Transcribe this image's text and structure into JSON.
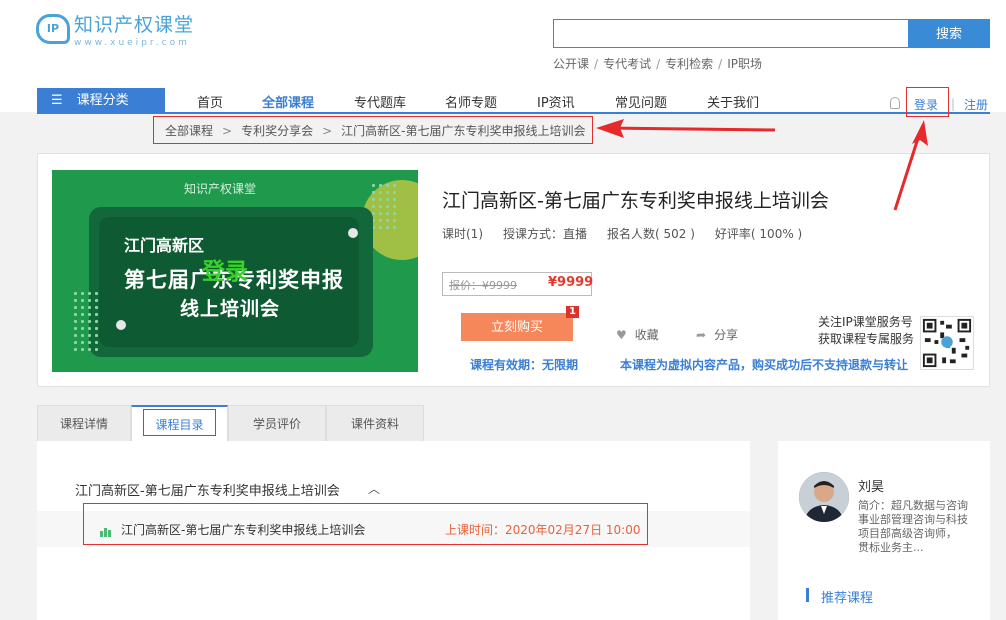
{
  "header": {
    "logo_cn": "知识产权课堂",
    "logo_en": "www.xueipr.com",
    "logo_mark": "IP",
    "search_placeholder": "",
    "search_button": "搜索",
    "quick_links": [
      "公开课",
      "专代考试",
      "专利检索",
      "IP职场"
    ]
  },
  "nav": {
    "category_label": "课程分类",
    "items": [
      "首页",
      "全部课程",
      "专代题库",
      "名师专题",
      "IP资讯",
      "常见问题",
      "关于我们"
    ],
    "active": "全部课程",
    "login": "登录",
    "register": "注册",
    "separator": "|"
  },
  "breadcrumb": [
    "全部课程",
    "专利奖分享会",
    "江门高新区-第七届广东专利奖申报线上培训会"
  ],
  "course": {
    "cover": {
      "logo": "知识产权课堂",
      "line1": "江门高新区",
      "line2": "第七届广东专利奖申报",
      "line3": "线上培训会",
      "overlay": "登录"
    },
    "title": "江门高新区-第七届广东专利奖申报线上培训会",
    "meta": [
      "课时(1)",
      "授课方式：直播",
      "报名人数( 502 )",
      "好评率( 100% )"
    ],
    "price_old": "报价：¥9999",
    "price_new": "¥9999",
    "buy_button": "立刻购买",
    "cart_badge": "1",
    "favorite": "收藏",
    "share": "分享",
    "validity": "课程有效期：无限期",
    "notice": "本课程为虚拟内容产品，购买成功后不支持退款与转让",
    "follow_line1": "关注IP课堂服务号",
    "follow_line2": "获取课程专属服务"
  },
  "tabs": [
    "课程详情",
    "课程目录",
    "学员评价",
    "课件资料"
  ],
  "active_tab": "课程目录",
  "catalog": {
    "chapter": "江门高新区-第七届广东专利奖申报线上培训会",
    "lesson_title": "江门高新区-第七届广东专利奖申报线上培训会",
    "lesson_time": "上课时间：2020年02月27日 10:00"
  },
  "teacher": {
    "name": "刘昊",
    "intro": "简介：超凡数据与咨询事业部管理咨询与科技项目部高级咨询师， 贯标业务主...",
    "recommend": "推荐课程"
  },
  "colors": {
    "accent": "#3a7fd5",
    "buy": "#f5875a",
    "price": "#e23b2e",
    "annotation": "#e42a2a"
  }
}
